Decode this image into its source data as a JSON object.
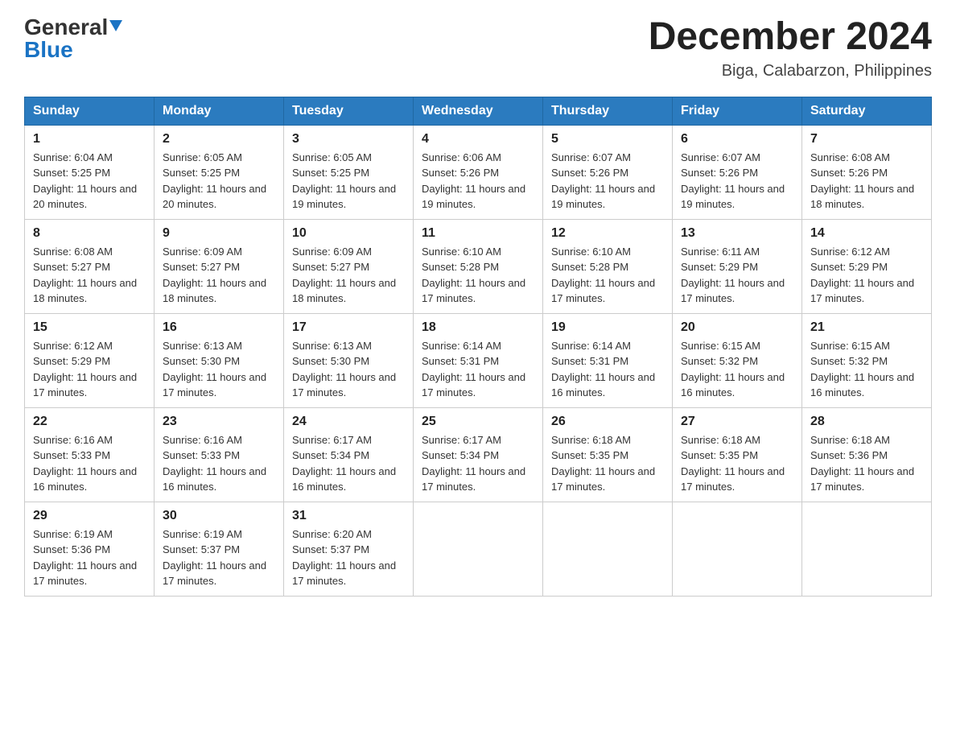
{
  "logo": {
    "general": "General",
    "blue": "Blue"
  },
  "title": "December 2024",
  "subtitle": "Biga, Calabarzon, Philippines",
  "days_of_week": [
    "Sunday",
    "Monday",
    "Tuesday",
    "Wednesday",
    "Thursday",
    "Friday",
    "Saturday"
  ],
  "weeks": [
    [
      {
        "day": "1",
        "sunrise": "Sunrise: 6:04 AM",
        "sunset": "Sunset: 5:25 PM",
        "daylight": "Daylight: 11 hours and 20 minutes."
      },
      {
        "day": "2",
        "sunrise": "Sunrise: 6:05 AM",
        "sunset": "Sunset: 5:25 PM",
        "daylight": "Daylight: 11 hours and 20 minutes."
      },
      {
        "day": "3",
        "sunrise": "Sunrise: 6:05 AM",
        "sunset": "Sunset: 5:25 PM",
        "daylight": "Daylight: 11 hours and 19 minutes."
      },
      {
        "day": "4",
        "sunrise": "Sunrise: 6:06 AM",
        "sunset": "Sunset: 5:26 PM",
        "daylight": "Daylight: 11 hours and 19 minutes."
      },
      {
        "day": "5",
        "sunrise": "Sunrise: 6:07 AM",
        "sunset": "Sunset: 5:26 PM",
        "daylight": "Daylight: 11 hours and 19 minutes."
      },
      {
        "day": "6",
        "sunrise": "Sunrise: 6:07 AM",
        "sunset": "Sunset: 5:26 PM",
        "daylight": "Daylight: 11 hours and 19 minutes."
      },
      {
        "day": "7",
        "sunrise": "Sunrise: 6:08 AM",
        "sunset": "Sunset: 5:26 PM",
        "daylight": "Daylight: 11 hours and 18 minutes."
      }
    ],
    [
      {
        "day": "8",
        "sunrise": "Sunrise: 6:08 AM",
        "sunset": "Sunset: 5:27 PM",
        "daylight": "Daylight: 11 hours and 18 minutes."
      },
      {
        "day": "9",
        "sunrise": "Sunrise: 6:09 AM",
        "sunset": "Sunset: 5:27 PM",
        "daylight": "Daylight: 11 hours and 18 minutes."
      },
      {
        "day": "10",
        "sunrise": "Sunrise: 6:09 AM",
        "sunset": "Sunset: 5:27 PM",
        "daylight": "Daylight: 11 hours and 18 minutes."
      },
      {
        "day": "11",
        "sunrise": "Sunrise: 6:10 AM",
        "sunset": "Sunset: 5:28 PM",
        "daylight": "Daylight: 11 hours and 17 minutes."
      },
      {
        "day": "12",
        "sunrise": "Sunrise: 6:10 AM",
        "sunset": "Sunset: 5:28 PM",
        "daylight": "Daylight: 11 hours and 17 minutes."
      },
      {
        "day": "13",
        "sunrise": "Sunrise: 6:11 AM",
        "sunset": "Sunset: 5:29 PM",
        "daylight": "Daylight: 11 hours and 17 minutes."
      },
      {
        "day": "14",
        "sunrise": "Sunrise: 6:12 AM",
        "sunset": "Sunset: 5:29 PM",
        "daylight": "Daylight: 11 hours and 17 minutes."
      }
    ],
    [
      {
        "day": "15",
        "sunrise": "Sunrise: 6:12 AM",
        "sunset": "Sunset: 5:29 PM",
        "daylight": "Daylight: 11 hours and 17 minutes."
      },
      {
        "day": "16",
        "sunrise": "Sunrise: 6:13 AM",
        "sunset": "Sunset: 5:30 PM",
        "daylight": "Daylight: 11 hours and 17 minutes."
      },
      {
        "day": "17",
        "sunrise": "Sunrise: 6:13 AM",
        "sunset": "Sunset: 5:30 PM",
        "daylight": "Daylight: 11 hours and 17 minutes."
      },
      {
        "day": "18",
        "sunrise": "Sunrise: 6:14 AM",
        "sunset": "Sunset: 5:31 PM",
        "daylight": "Daylight: 11 hours and 17 minutes."
      },
      {
        "day": "19",
        "sunrise": "Sunrise: 6:14 AM",
        "sunset": "Sunset: 5:31 PM",
        "daylight": "Daylight: 11 hours and 16 minutes."
      },
      {
        "day": "20",
        "sunrise": "Sunrise: 6:15 AM",
        "sunset": "Sunset: 5:32 PM",
        "daylight": "Daylight: 11 hours and 16 minutes."
      },
      {
        "day": "21",
        "sunrise": "Sunrise: 6:15 AM",
        "sunset": "Sunset: 5:32 PM",
        "daylight": "Daylight: 11 hours and 16 minutes."
      }
    ],
    [
      {
        "day": "22",
        "sunrise": "Sunrise: 6:16 AM",
        "sunset": "Sunset: 5:33 PM",
        "daylight": "Daylight: 11 hours and 16 minutes."
      },
      {
        "day": "23",
        "sunrise": "Sunrise: 6:16 AM",
        "sunset": "Sunset: 5:33 PM",
        "daylight": "Daylight: 11 hours and 16 minutes."
      },
      {
        "day": "24",
        "sunrise": "Sunrise: 6:17 AM",
        "sunset": "Sunset: 5:34 PM",
        "daylight": "Daylight: 11 hours and 16 minutes."
      },
      {
        "day": "25",
        "sunrise": "Sunrise: 6:17 AM",
        "sunset": "Sunset: 5:34 PM",
        "daylight": "Daylight: 11 hours and 17 minutes."
      },
      {
        "day": "26",
        "sunrise": "Sunrise: 6:18 AM",
        "sunset": "Sunset: 5:35 PM",
        "daylight": "Daylight: 11 hours and 17 minutes."
      },
      {
        "day": "27",
        "sunrise": "Sunrise: 6:18 AM",
        "sunset": "Sunset: 5:35 PM",
        "daylight": "Daylight: 11 hours and 17 minutes."
      },
      {
        "day": "28",
        "sunrise": "Sunrise: 6:18 AM",
        "sunset": "Sunset: 5:36 PM",
        "daylight": "Daylight: 11 hours and 17 minutes."
      }
    ],
    [
      {
        "day": "29",
        "sunrise": "Sunrise: 6:19 AM",
        "sunset": "Sunset: 5:36 PM",
        "daylight": "Daylight: 11 hours and 17 minutes."
      },
      {
        "day": "30",
        "sunrise": "Sunrise: 6:19 AM",
        "sunset": "Sunset: 5:37 PM",
        "daylight": "Daylight: 11 hours and 17 minutes."
      },
      {
        "day": "31",
        "sunrise": "Sunrise: 6:20 AM",
        "sunset": "Sunset: 5:37 PM",
        "daylight": "Daylight: 11 hours and 17 minutes."
      },
      {
        "day": "",
        "sunrise": "",
        "sunset": "",
        "daylight": ""
      },
      {
        "day": "",
        "sunrise": "",
        "sunset": "",
        "daylight": ""
      },
      {
        "day": "",
        "sunrise": "",
        "sunset": "",
        "daylight": ""
      },
      {
        "day": "",
        "sunrise": "",
        "sunset": "",
        "daylight": ""
      }
    ]
  ]
}
